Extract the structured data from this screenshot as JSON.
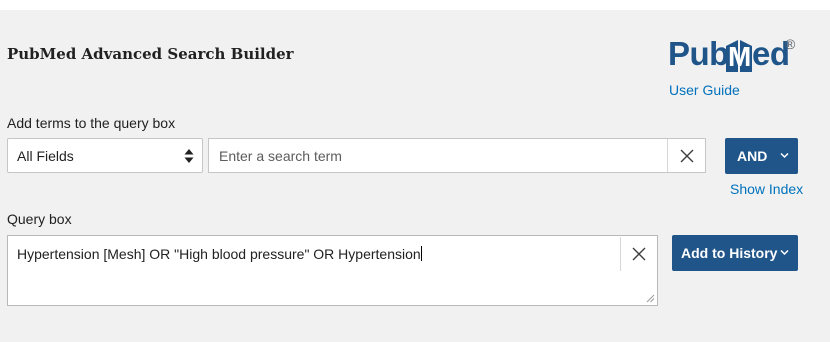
{
  "header": {
    "title": "PubMed Advanced Search Builder",
    "logo": {
      "part1": "Pub",
      "part2": "Med",
      "reg": "®",
      "brand_color": "#20558a"
    },
    "user_guide_label": "User Guide"
  },
  "builder": {
    "section_label": "Add terms to the query box",
    "field_select_value": "All Fields",
    "term_placeholder": "Enter a search term",
    "term_value": "",
    "clear_icon": "close-icon",
    "operator_label": "AND",
    "show_index_label": "Show Index"
  },
  "query": {
    "section_label": "Query box",
    "text": "Hypertension [Mesh] OR \"High blood pressure\" OR Hypertension",
    "clear_icon": "close-icon",
    "add_to_history_label": "Add to History"
  },
  "colors": {
    "accent": "#20558a",
    "link": "#0071bc",
    "panel_bg": "#f1f1f1"
  }
}
